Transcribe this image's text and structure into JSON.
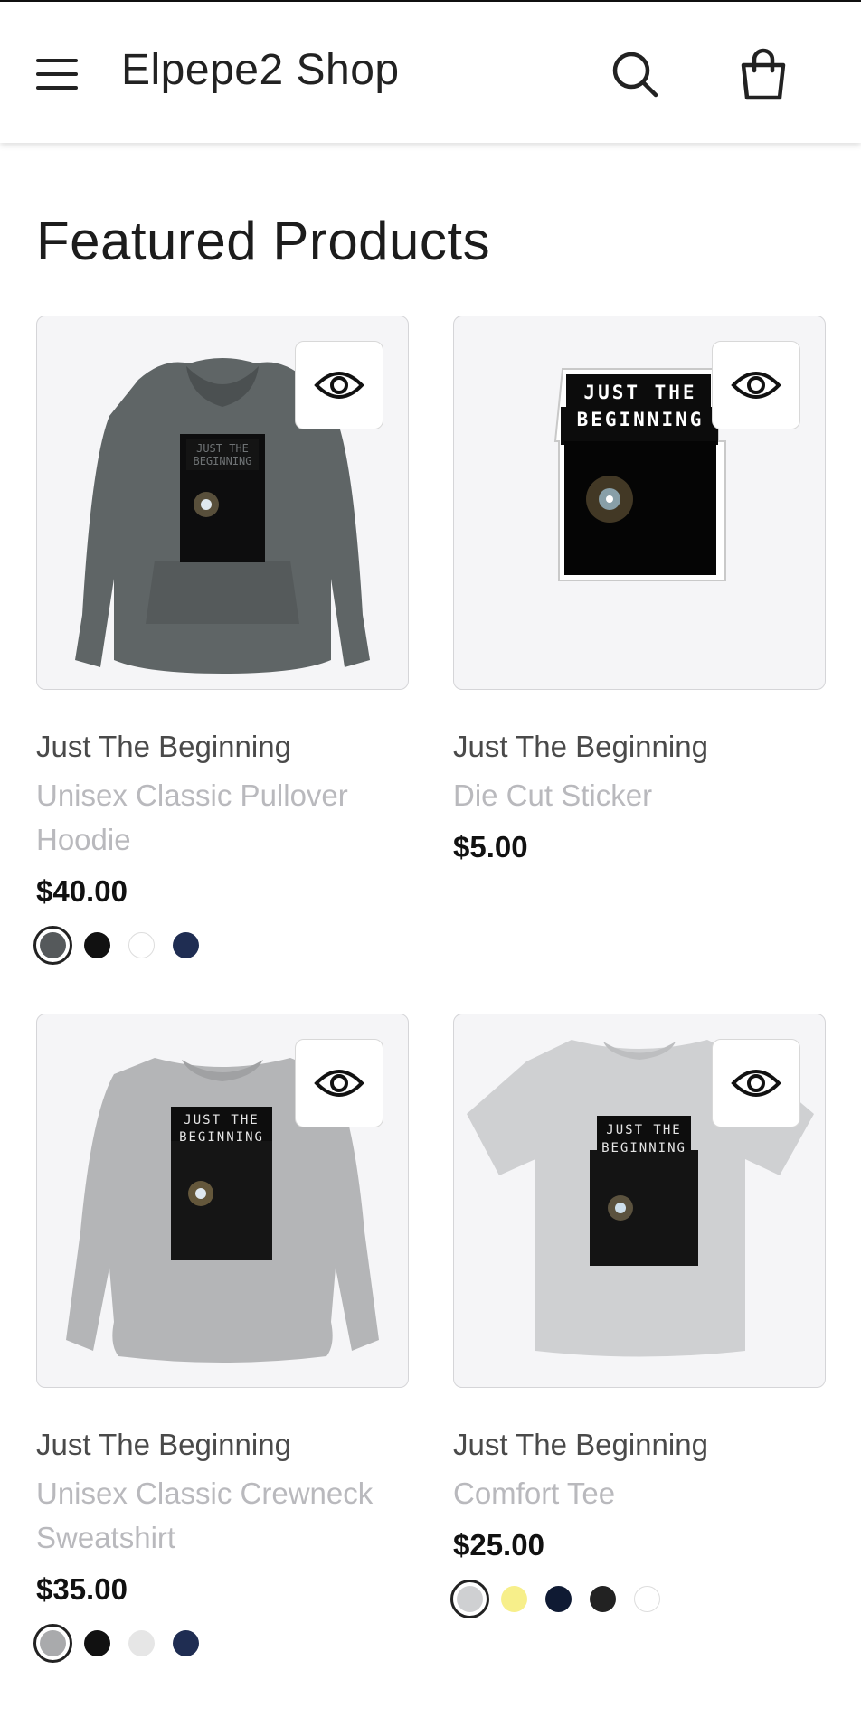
{
  "header": {
    "shop_name": "Elpepe2 Shop",
    "menu_icon": "hamburger-menu-icon",
    "search_icon": "search-icon",
    "cart_icon": "shopping-bag-icon"
  },
  "main": {
    "heading": "Featured Products",
    "products": [
      {
        "title": "Just The Beginning",
        "type": "Unisex Classic Pullover Hoodie",
        "price": "$40.00",
        "print_text_1": "JUST THE",
        "print_text_2": "BEGINNING",
        "garment_color": "#5f6566",
        "colors": [
          "#55595b",
          "#111111",
          "#ffffff",
          "#1f2d52"
        ],
        "selected_color_index": 0
      },
      {
        "title": "Just The Beginning",
        "type": "Die Cut Sticker",
        "price": "$5.00",
        "print_text_1": "JUST THE",
        "print_text_2": "BEGINNING",
        "colors": []
      },
      {
        "title": "Just The Beginning",
        "type": "Unisex Classic Crewneck Sweatshirt",
        "price": "$35.00",
        "print_text_1": "JUST THE",
        "print_text_2": "BEGINNING",
        "garment_color": "#b4b5b7",
        "colors": [
          "#a9aaac",
          "#111111",
          "#e6e6e6",
          "#1f2d52"
        ],
        "selected_color_index": 0
      },
      {
        "title": "Just The Beginning",
        "type": "Comfort Tee",
        "price": "$25.00",
        "print_text_1": "JUST THE",
        "print_text_2": "BEGINNING",
        "garment_color": "#cfd0d2",
        "colors": [
          "#cfd0d2",
          "#f7ef8a",
          "#0f1a33",
          "#222222",
          "#ffffff"
        ],
        "selected_color_index": 0
      }
    ]
  }
}
